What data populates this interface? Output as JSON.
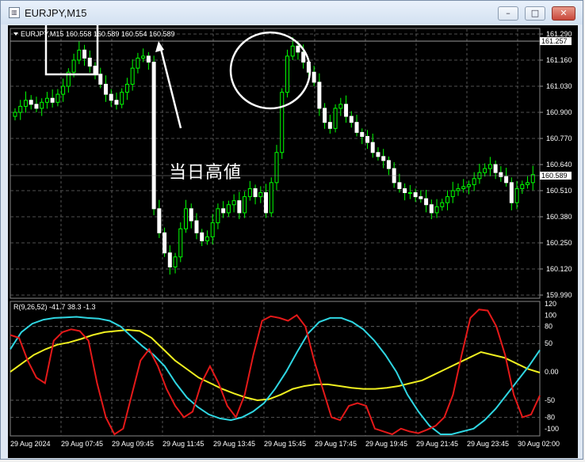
{
  "window": {
    "title": "EURJPY,M15",
    "icon": "chart-window-icon",
    "buttons": {
      "minimize": "–",
      "maximize": "□",
      "close": "✕"
    }
  },
  "main_chart": {
    "header": "EURJPY,M15  160.558 160.589 160.554 160.589",
    "price_axis": [
      "161.290",
      "161.160",
      "161.030",
      "160.900",
      "160.770",
      "160.640",
      "160.510",
      "160.380",
      "160.250",
      "160.120",
      "159.990"
    ],
    "high_label": "161.257",
    "current_label": "160.589",
    "colors": {
      "up": "#00ff00",
      "down": "#ffffff",
      "grid": "#6b6b6b",
      "bg": "#000000"
    }
  },
  "annotation": {
    "text": "当日高値"
  },
  "indicator": {
    "header": "R(9,26,52) -41.7 38.3 -1.3",
    "axis": [
      "120",
      "100",
      "80",
      "50",
      "0.00",
      "-50",
      "-80",
      "-100"
    ],
    "colors": {
      "red": "#e41919",
      "cyan": "#2fd6e2",
      "yellow": "#f0f020"
    }
  },
  "time_axis": [
    "29 Aug 2024",
    "29 Aug 07:45",
    "29 Aug 09:45",
    "29 Aug 11:45",
    "29 Aug 13:45",
    "29 Aug 15:45",
    "29 Aug 17:45",
    "29 Aug 19:45",
    "29 Aug 21:45",
    "29 Aug 23:45",
    "30 Aug 02:00"
  ]
}
